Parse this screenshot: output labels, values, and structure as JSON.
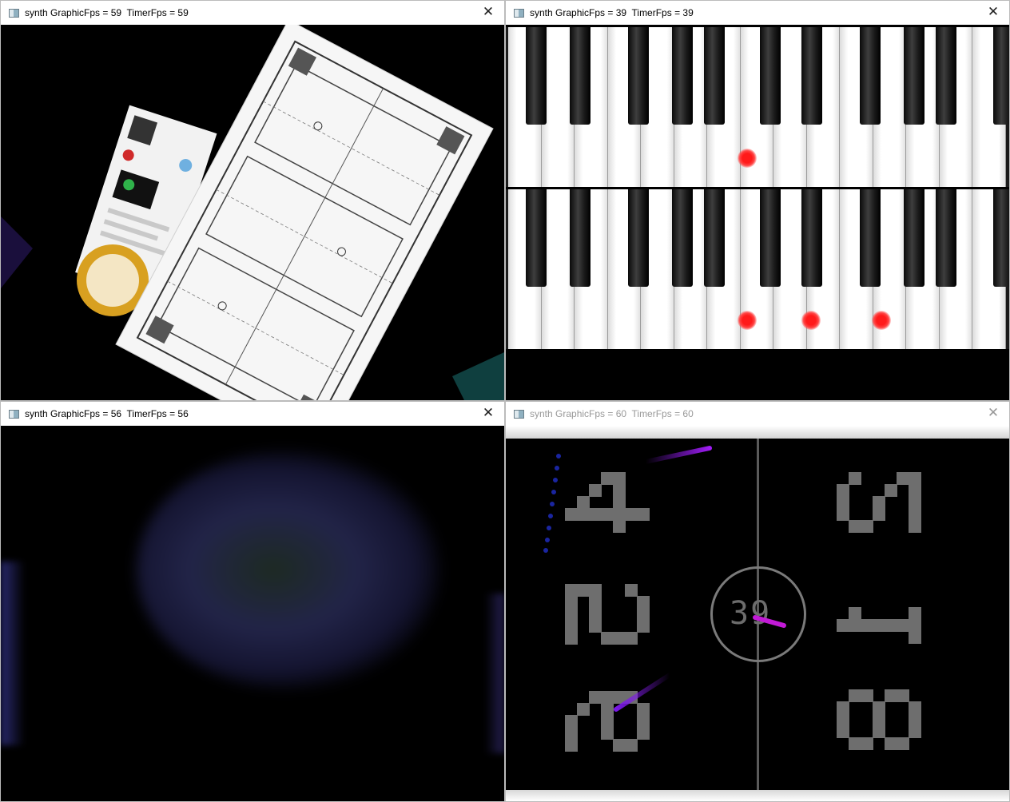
{
  "windows": [
    {
      "title": "synth GraphicFps = 59  TimerFps = 59",
      "close_glyph": "✕",
      "icon": "app-window-icon"
    },
    {
      "title": "synth GraphicFps = 39  TimerFps = 39",
      "close_glyph": "✕",
      "icon": "app-window-icon"
    },
    {
      "title": "synth GraphicFps = 56  TimerFps = 56",
      "close_glyph": "✕",
      "icon": "app-window-icon"
    },
    {
      "title": "synth GraphicFps = 60  TimerFps = 60",
      "close_glyph": "✕",
      "icon": "app-window-icon"
    }
  ],
  "piano": {
    "active_dots_top": [
      1
    ],
    "active_dots_bottom": [
      1,
      2,
      3
    ]
  },
  "pong": {
    "center_text": "39",
    "left_digits": [
      "4",
      "5",
      "6"
    ],
    "right_digits": [
      "2",
      "1",
      "8"
    ],
    "accent": "#8a1cf0"
  }
}
